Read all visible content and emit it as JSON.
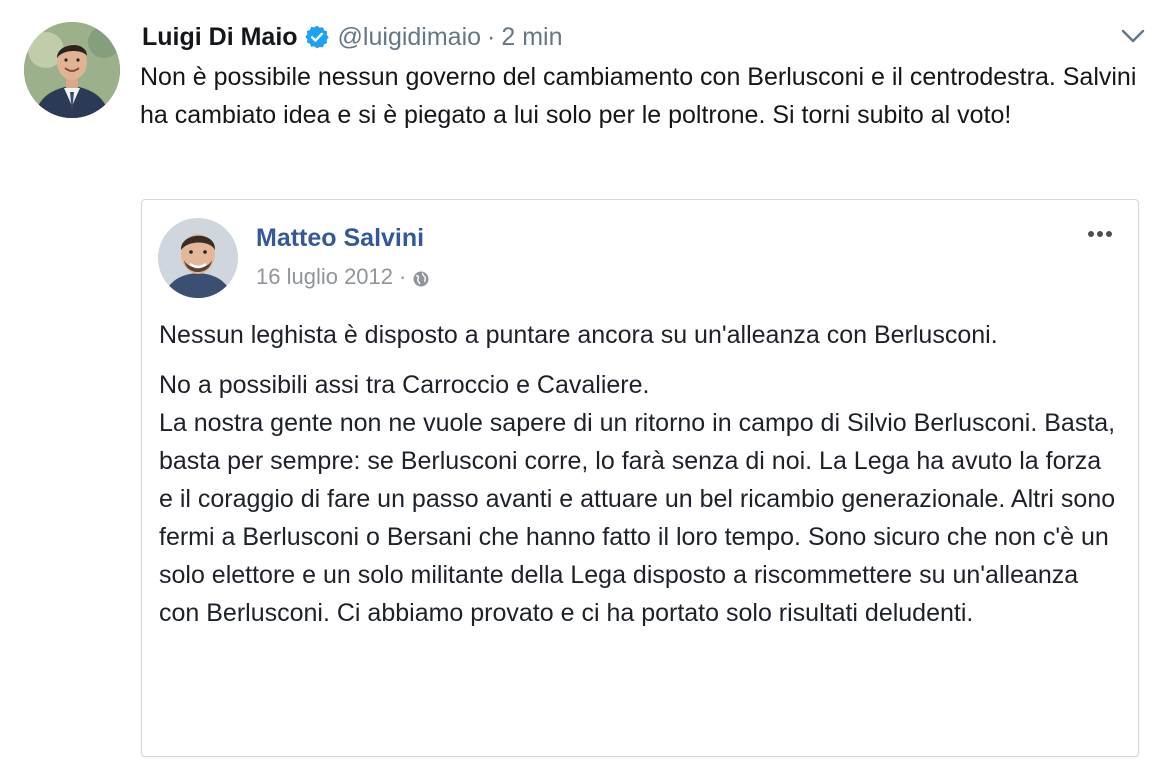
{
  "tweet": {
    "author_name": "Luigi Di Maio",
    "handle": "@luigidimaio",
    "separator": "·",
    "time": "2 min",
    "text": "Non è possibile nessun governo del cambiamento con Berlusconi e il centrodestra. Salvini ha cambiato idea e si è piegato a lui solo per le poltrone. Si torni subito al voto!",
    "icons": {
      "verified": "verified-badge-icon",
      "menu": "chevron-down-icon"
    },
    "colors": {
      "verified": "#1da1f2",
      "secondary_text": "#657786"
    }
  },
  "embedded_post": {
    "author_name": "Matteo Salvini",
    "date": "16 luglio 2012",
    "separator": "·",
    "icons": {
      "privacy": "globe-icon",
      "more": "more-options-icon"
    },
    "paragraph1": "Nessun leghista è disposto a puntare ancora su un'alleanza con Berlusconi.",
    "paragraph2_line1": "No a possibili assi tra Carroccio e Cavaliere.",
    "paragraph2_rest": "La nostra gente non ne vuole sapere di un ritorno in campo di Silvio Berlusconi. Basta, basta per sempre: se Berlusconi corre, lo farà senza di noi. La Lega ha avuto la forza e il coraggio di fare un passo avanti e attuare un bel ricambio generazionale. Altri sono fermi a Berlusconi o Bersani che hanno fatto il loro tempo. Sono sicuro che non c'è un solo elettore e un solo militante della Lega disposto a riscommettere su un'alleanza con Berlusconi. Ci abbiamo provato e ci ha portato solo risultati deludenti.",
    "colors": {
      "name": "#365899",
      "meta": "#90949c"
    }
  }
}
